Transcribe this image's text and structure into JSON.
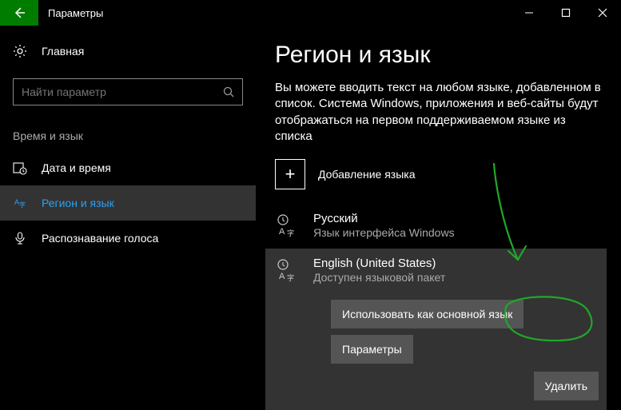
{
  "window": {
    "title": "Параметры"
  },
  "sidebar": {
    "home": "Главная",
    "search_placeholder": "Найти параметр",
    "category": "Время и язык",
    "items": [
      {
        "label": "Дата и время",
        "icon": "clock-calendar-icon"
      },
      {
        "label": "Регион и язык",
        "icon": "language-icon"
      },
      {
        "label": "Распознавание голоса",
        "icon": "microphone-icon"
      }
    ]
  },
  "page": {
    "title": "Регион и язык",
    "description": "Вы можете вводить текст на любом языке, добавленном в список. Система Windows, приложения и веб-сайты будут отображаться на первом поддерживаемом языке из списка",
    "add_language": "Добавление языка",
    "languages": [
      {
        "name": "Русский",
        "subtitle": "Язык интерфейса Windows"
      },
      {
        "name": "English (United States)",
        "subtitle": "Доступен языковой пакет"
      }
    ],
    "buttons": {
      "set_default": "Использовать как основной язык",
      "options": "Параметры",
      "remove": "Удалить"
    }
  },
  "annotation": {
    "color": "#1fa82a"
  }
}
